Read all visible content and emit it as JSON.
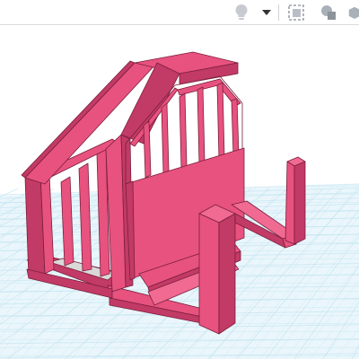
{
  "toolbar": {
    "tools": [
      {
        "name": "lightbulb-icon"
      },
      {
        "name": "chevron-down-icon"
      },
      {
        "name": "view-box-icon"
      },
      {
        "name": "shapes-icon"
      },
      {
        "name": "cube-icon"
      }
    ]
  },
  "viewport": {
    "grid_color": "#bfe3f2",
    "grid_background": "#eaf6fb",
    "model_color": "#e8527f",
    "model_shadow": "#c23a66"
  }
}
